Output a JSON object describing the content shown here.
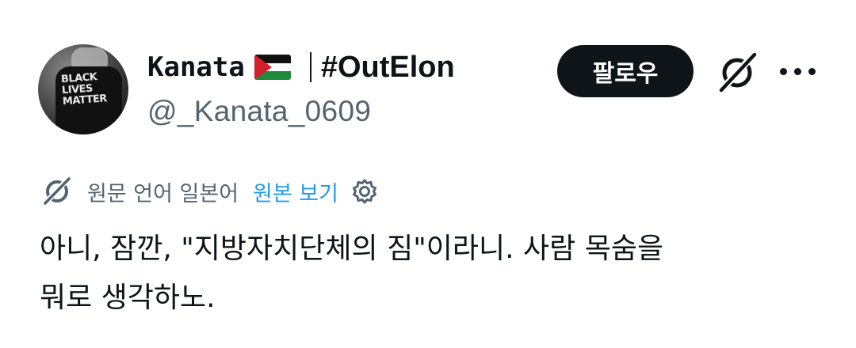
{
  "user": {
    "display_name": "Kanata",
    "flag_icon": "palestine-flag-icon",
    "hashtag": "#OutElon",
    "handle": "@_Kanata_0609",
    "avatar_text": "BLACK LIVES MATTER"
  },
  "actions": {
    "follow_label": "팔로우",
    "grok_icon": "grok-icon",
    "more_icon": "more-dots-icon"
  },
  "translation": {
    "label": "원문 언어 일본어",
    "show_original": "원본 보기",
    "settings_icon": "gear-icon"
  },
  "tweet": {
    "text": "아니, 잠깐, \"지방자치단체의 짐\"이라니. 사람 목숨을\n뭐로 생각하노."
  },
  "colors": {
    "text": "#0f1419",
    "secondary": "#536471",
    "link": "#1d9bf0",
    "button_bg": "#0f1419"
  }
}
